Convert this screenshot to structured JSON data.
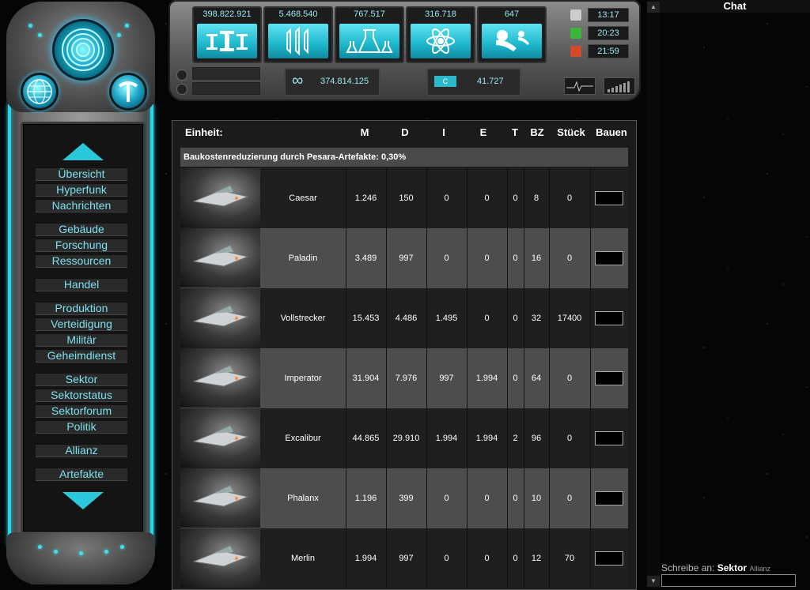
{
  "nav": {
    "items": [
      "Übersicht",
      "Hyperfunk",
      "Nachrichten",
      "Gebäude",
      "Forschung",
      "Ressourcen",
      "Handel",
      "Produktion",
      "Verteidigung",
      "Militär",
      "Geheimdienst",
      "Sektor",
      "Sektorstatus",
      "Sektorforum",
      "Politik",
      "Allianz",
      "Artefakte"
    ]
  },
  "resources": [
    {
      "value": "398.822.921",
      "icon": "metal-icon"
    },
    {
      "value": "5.468.540",
      "icon": "crystal-icon"
    },
    {
      "value": "767.517",
      "icon": "chemicals-icon"
    },
    {
      "value": "316.718",
      "icon": "atom-icon"
    },
    {
      "value": "647",
      "icon": "population-icon"
    }
  ],
  "times": [
    {
      "value": "13:17",
      "icon": "hourglass-icon",
      "color": "#cccccc"
    },
    {
      "value": "20:23",
      "icon": "check-icon",
      "color": "#3ab53a"
    },
    {
      "value": "21:59",
      "icon": "cross-icon",
      "color": "#d24a2a"
    }
  ],
  "sub": {
    "infinity_value": "374.814.125",
    "credits_label": "C",
    "credits_value": "41.727"
  },
  "table": {
    "headers": {
      "unit": "Einheit:",
      "m": "M",
      "d": "D",
      "i": "I",
      "e": "E",
      "t": "T",
      "bz": "BZ",
      "count": "Stück",
      "build": "Bauen"
    },
    "banner": "Baukostenreduzierung durch Pesara-Artefakte: 0,30%",
    "rows": [
      {
        "name": "Caesar",
        "m": "1.246",
        "d": "150",
        "i": "0",
        "e": "0",
        "t": "0",
        "bz": "8",
        "count": "0"
      },
      {
        "name": "Paladin",
        "m": "3.489",
        "d": "997",
        "i": "0",
        "e": "0",
        "t": "0",
        "bz": "16",
        "count": "0"
      },
      {
        "name": "Vollstrecker",
        "m": "15.453",
        "d": "4.486",
        "i": "1.495",
        "e": "0",
        "t": "0",
        "bz": "32",
        "count": "17400"
      },
      {
        "name": "Imperator",
        "m": "31.904",
        "d": "7.976",
        "i": "997",
        "e": "1.994",
        "t": "0",
        "bz": "64",
        "count": "0"
      },
      {
        "name": "Excalibur",
        "m": "44.865",
        "d": "29.910",
        "i": "1.994",
        "e": "1.994",
        "t": "2",
        "bz": "96",
        "count": "0"
      },
      {
        "name": "Phalanx",
        "m": "1.196",
        "d": "399",
        "i": "0",
        "e": "0",
        "t": "0",
        "bz": "10",
        "count": "0"
      },
      {
        "name": "Merlin",
        "m": "1.994",
        "d": "997",
        "i": "0",
        "e": "0",
        "t": "0",
        "bz": "12",
        "count": "70"
      }
    ]
  },
  "chat": {
    "title": "Chat",
    "write_label": "Schreibe an:",
    "target": "Sektor",
    "alt_target": "Allianz"
  }
}
